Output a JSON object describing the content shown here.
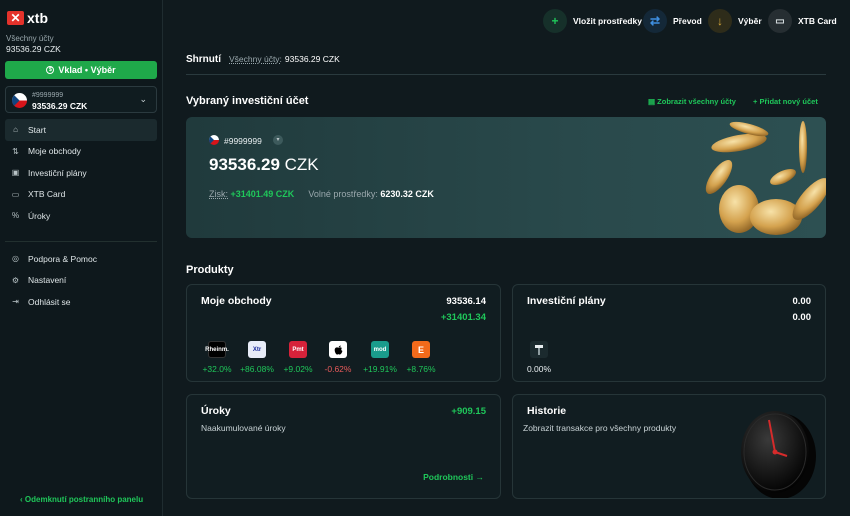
{
  "brand": {
    "name": "xtb",
    "mark": "✕"
  },
  "sidebar": {
    "all_accounts_label": "Všechny účty",
    "all_accounts_balance": "93536.29  CZK",
    "deposit_button": "Vklad • Výběr",
    "account": {
      "number": "#9999999",
      "balance": "93536.29 CZK"
    },
    "nav": [
      {
        "label": "Start",
        "icon": "home-icon"
      },
      {
        "label": "Moje obchody",
        "icon": "trades-icon"
      },
      {
        "label": "Investiční plány",
        "icon": "plans-icon"
      },
      {
        "label": "XTB Card",
        "icon": "card-icon"
      },
      {
        "label": "Úroky",
        "icon": "percent-icon"
      }
    ],
    "nav2": [
      {
        "label": "Podpora & Pomoc",
        "icon": "support-icon"
      },
      {
        "label": "Nastavení",
        "icon": "gear-icon"
      },
      {
        "label": "Odhlásit se",
        "icon": "logout-icon"
      }
    ],
    "collapse_label": "Odemknutí postranního panelu"
  },
  "topbar": {
    "deposit": "Vložit prostředky",
    "transfer": "Převod",
    "withdraw": "Výběr",
    "card": "XTB Card"
  },
  "summary": {
    "title": "Shrnutí",
    "label": "Všechny účty:",
    "value": "93536.29  CZK"
  },
  "selected": {
    "title": "Vybraný investiční účet",
    "show_all": "Zobrazit všechny účty",
    "add_new": "+ Přidat nový účet",
    "account_number": "#9999999",
    "balance_value": "93536.29",
    "balance_currency": " CZK",
    "gain_label": "Zisk:",
    "gain_value": "+31401.49 CZK",
    "free_label": "Volné prostředky:",
    "free_value": "6230.32 CZK"
  },
  "products": {
    "title": "Produkty",
    "trades": {
      "title": "Moje obchody",
      "value": "93536.14",
      "change": "+31401.34",
      "stocks": [
        {
          "logo": "Rheinm.",
          "pct": "+32.0%",
          "bg": "#000000",
          "fg": "#ffffff",
          "dir": "pos"
        },
        {
          "logo": "Xtr",
          "pct": "+86.08%",
          "bg": "#e8ecf8",
          "fg": "#1a2a9a",
          "dir": "pos"
        },
        {
          "logo": "Pmt",
          "pct": "+9.02%",
          "bg": "#d6223a",
          "fg": "#ffffff",
          "dir": "pos"
        },
        {
          "logo": "",
          "pct": "-0.62%",
          "bg": "#ffffff",
          "fg": "#000000",
          "dir": "neg"
        },
        {
          "logo": "mod",
          "pct": "+19.91%",
          "bg": "#1a9c8c",
          "fg": "#ffffff",
          "dir": "pos"
        },
        {
          "logo": "E",
          "pct": "+8.76%",
          "bg": "#f26a1b",
          "fg": "#ffffff",
          "dir": "pos"
        }
      ]
    },
    "plans": {
      "title": "Investiční plány",
      "value": "0.00",
      "value2": "0.00",
      "pct": "0.00%"
    },
    "interest": {
      "title": "Úroky",
      "value": "+909.15",
      "subtitle": "Naakumulované úroky",
      "details": "Podrobnosti →"
    },
    "history": {
      "title": "Historie",
      "subtitle": "Zobrazit transakce pro všechny produkty"
    }
  },
  "colors": {
    "accent": "#1fa84a",
    "positive": "#1fc75a",
    "negative": "#e85b5b"
  }
}
